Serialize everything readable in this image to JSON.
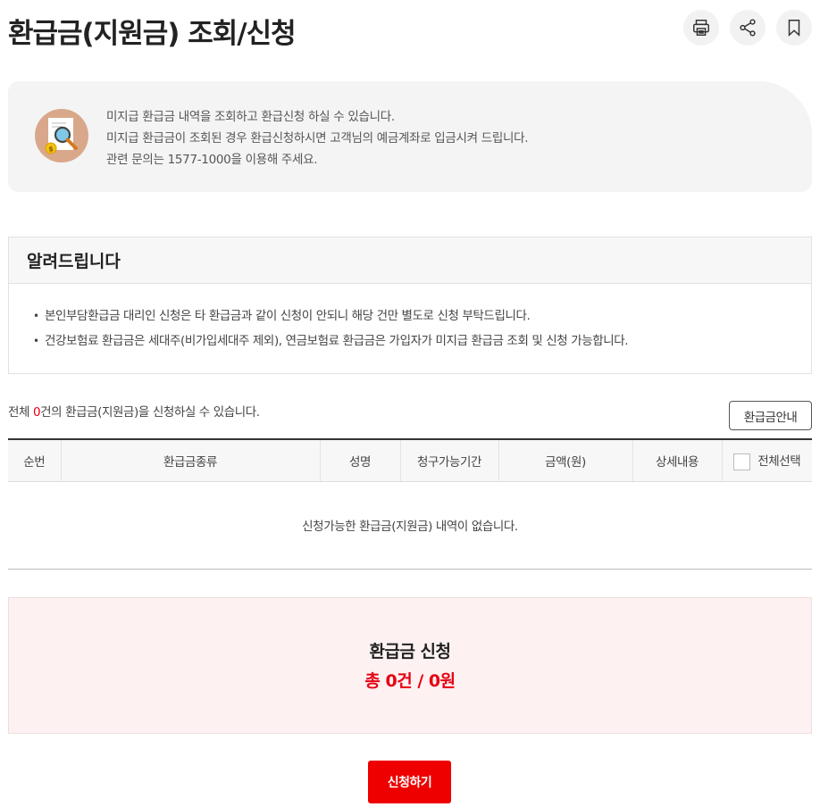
{
  "header": {
    "title": "환급금(지원금) 조회/신청",
    "tools": [
      {
        "icon": "print-icon"
      },
      {
        "icon": "share-icon"
      },
      {
        "icon": "bookmark-icon"
      }
    ]
  },
  "info": {
    "icon": "search-document-icon",
    "lines": [
      "미지급 환급금 내역을 조회하고 환급신청 하실 수 있습니다.",
      "미지급 환급금이 조회된 경우 환급신청하시면 고객님의 예금계좌로 입금시켜 드립니다.",
      "관련 문의는 1577-1000을 이용해 주세요."
    ]
  },
  "notice": {
    "title": "알려드립니다",
    "items": [
      "본인부담환급금 대리인 신청은 타 환급금과 같이 신청이 안되니 해당 건만 별도로 신청 부탁드립니다.",
      "건강보험료 환급금은 세대주(비가입세대주 제외), 연금보험료 환급금은 가입자가 미지급 환급금 조회 및 신청 가능합니다."
    ]
  },
  "summary": {
    "prefix": "전체 ",
    "count": "0",
    "suffix": "건의 환급금(지원금)을 신청하실 수 있습니다."
  },
  "guide_button": "환급금안내",
  "table": {
    "columns": [
      "순번",
      "환급금종류",
      "성명",
      "청구가능기간",
      "금액(원)",
      "상세내용",
      "전체선택"
    ],
    "empty_message": "신청가능한 환급금(지원금) 내역이 없습니다."
  },
  "apply": {
    "title": "환급금 신청",
    "total": "총 0건 / 0원"
  },
  "submit_button": "신청하기",
  "colors": {
    "accent": "#e60012",
    "button": "#ee0000"
  }
}
